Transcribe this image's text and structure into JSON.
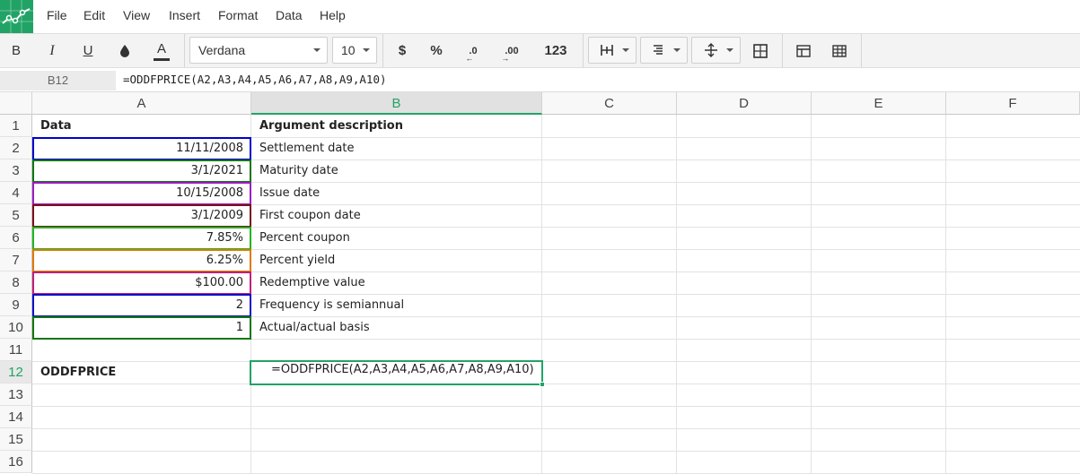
{
  "menu": [
    "File",
    "Edit",
    "View",
    "Insert",
    "Format",
    "Data",
    "Help"
  ],
  "toolbar": {
    "bold": "B",
    "italic": "I",
    "underline": "U",
    "font_name": "Verdana",
    "font_size": "10",
    "currency": "$",
    "percent": "%",
    "dec_decrease": ".0",
    "dec_increase": ".00",
    "number_format": "123"
  },
  "formula_bar": {
    "name_box": "B12",
    "formula": "=ODDFPRICE(A2,A3,A4,A5,A6,A7,A8,A9,A10)"
  },
  "columns": [
    "A",
    "B",
    "C",
    "D",
    "E",
    "F"
  ],
  "rows": [
    "1",
    "2",
    "3",
    "4",
    "5",
    "6",
    "7",
    "8",
    "9",
    "10",
    "11",
    "12",
    "13",
    "14",
    "15",
    "16"
  ],
  "cells": {
    "A1": "Data",
    "B1": "Argument description",
    "A2": "11/11/2008",
    "B2": "Settlement date",
    "A3": "3/1/2021",
    "B3": "Maturity date",
    "A4": "10/15/2008",
    "B4": "Issue date",
    "A5": "3/1/2009",
    "B5": "First coupon date",
    "A6": "7.85%",
    "B6": "Percent coupon",
    "A7": "6.25%",
    "B7": "Percent yield",
    "A8": "$100.00",
    "B8": "Redemptive value",
    "A9": "2",
    "B9": "Frequency is semiannual",
    "A10": "1",
    "B10": "Actual/actual basis",
    "A12": "ODDFPRICE",
    "B12": "=ODDFPRICE(A2,A3,A4,A5,A6,A7,A8,A9,A10)"
  },
  "colors": {
    "accent": "#21a366",
    "ref_A2": "#0000cc",
    "ref_A3": "#117711",
    "ref_A4": "#9a1fc0",
    "ref_A5": "#7a0f1e",
    "ref_A6": "#22b522",
    "ref_A7": "#e07a00",
    "ref_A8": "#c0207a",
    "ref_A9": "#1010c8",
    "ref_A10": "#117711"
  }
}
